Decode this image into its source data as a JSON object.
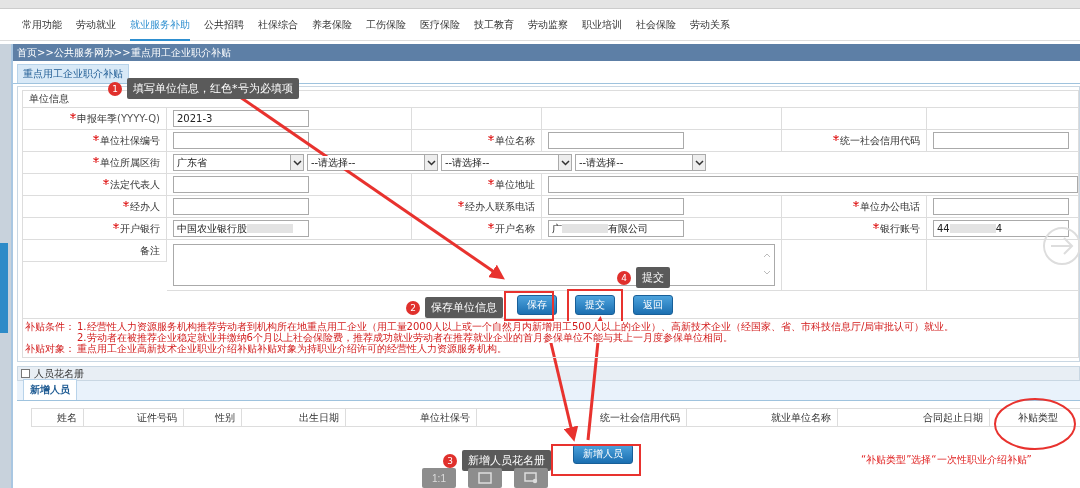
{
  "nav": {
    "items": [
      {
        "label": "常用功能",
        "selected": false
      },
      {
        "label": "劳动就业",
        "selected": false
      },
      {
        "label": "就业服务补助",
        "selected": true
      },
      {
        "label": "公共招聘",
        "selected": false
      },
      {
        "label": "社保综合",
        "selected": false
      },
      {
        "label": "养老保险",
        "selected": false
      },
      {
        "label": "工伤保险",
        "selected": false
      },
      {
        "label": "医疗保险",
        "selected": false
      },
      {
        "label": "技工教育",
        "selected": false
      },
      {
        "label": "劳动监察",
        "selected": false
      },
      {
        "label": "职业培训",
        "selected": false
      },
      {
        "label": "社会保险",
        "selected": false
      },
      {
        "label": "劳动关系",
        "selected": false
      }
    ]
  },
  "breadcrumb": "首页>>公共服务网办>>重点用工企业职介补贴",
  "tabs": [
    {
      "label": "重点用工企业职介补贴",
      "selected": true
    }
  ],
  "form": {
    "section_title": "单位信息",
    "rows": [
      [
        {
          "kind": "text",
          "label": "申报年季",
          "hint": "(YYYY-Q)",
          "required": true,
          "value": "2021-3"
        }
      ],
      [
        {
          "kind": "text",
          "label": "单位社保编号",
          "required": true
        },
        {
          "kind": "text",
          "label": "单位名称",
          "required": true
        },
        {
          "kind": "text",
          "label": "统一社会信用代码",
          "required": true
        }
      ],
      [
        {
          "kind": "selects",
          "label": "单位所属区街",
          "required": true,
          "selects": [
            {
              "value": "广东省"
            },
            {
              "value": "--请选择--"
            },
            {
              "value": "--请选择--"
            },
            {
              "value": "--请选择--"
            }
          ]
        }
      ],
      [
        {
          "kind": "text",
          "label": "法定代表人",
          "required": true
        },
        {
          "kind": "wide",
          "label": "单位地址",
          "required": true
        }
      ],
      [
        {
          "kind": "text",
          "label": "经办人",
          "required": true
        },
        {
          "kind": "text",
          "label": "经办人联系电话",
          "required": true
        },
        {
          "kind": "text",
          "label": "单位办公电话",
          "required": true
        }
      ],
      [
        {
          "kind": "text",
          "label": "开户银行",
          "required": true,
          "value": "中国农业银行股",
          "blurred": true
        },
        {
          "kind": "text",
          "label": "开户名称",
          "required": true,
          "value": "广",
          "blurred": true,
          "value_end": "有限公司"
        },
        {
          "kind": "text",
          "label": "银行账号",
          "required": true,
          "value": "44",
          "blurred": true,
          "value_end": "4"
        }
      ],
      [
        {
          "kind": "textarea",
          "label": "备注",
          "required": false
        }
      ]
    ],
    "buttons": [
      "保存",
      "提交",
      "返回"
    ],
    "notes": [
      {
        "heading": "补贴条件：",
        "text": "1.经营性人力资源服务机构推荐劳动者到机构所在地重点用工企业（用工量2000人以上或一个自然月内新增用工500人以上的企业）、高新技术企业（经国家、省、市科技信息厅/局审批认可）就业。"
      },
      {
        "text": "2.劳动者在被推荐企业稳定就业并缴纳6个月以上社会保险费，推荐成功就业劳动者在推荐就业企业的首月参保单位不能与其上一月度参保单位相同。"
      },
      {
        "heading": "补贴对象：",
        "text": "重点用工企业高新技术企业职业介绍补贴补贴对象为持职业介绍许可的经营性人力资源服务机构。"
      }
    ]
  },
  "roster": {
    "title": "人员花名册",
    "tabs": [
      {
        "label": "新增人员",
        "selected": true
      }
    ],
    "columns": [
      "姓名",
      "证件号码",
      "性别",
      "出生日期",
      "单位社保号",
      "统一社会信用代码",
      "就业单位名称",
      "合同起止日期",
      "补贴类型"
    ],
    "add_button": "新增人员"
  },
  "annotations": [
    {
      "number": "1",
      "text": "填写单位信息，红色*号为必填项"
    },
    {
      "number": "2",
      "text": "保存单位信息"
    },
    {
      "number": "4",
      "text": "提交"
    },
    {
      "number": "3",
      "text": "新增人员花名册"
    }
  ],
  "note": "“补贴类型”选择“一次性职业介绍补贴”",
  "viewer": {
    "zoom_label": "1:1"
  }
}
